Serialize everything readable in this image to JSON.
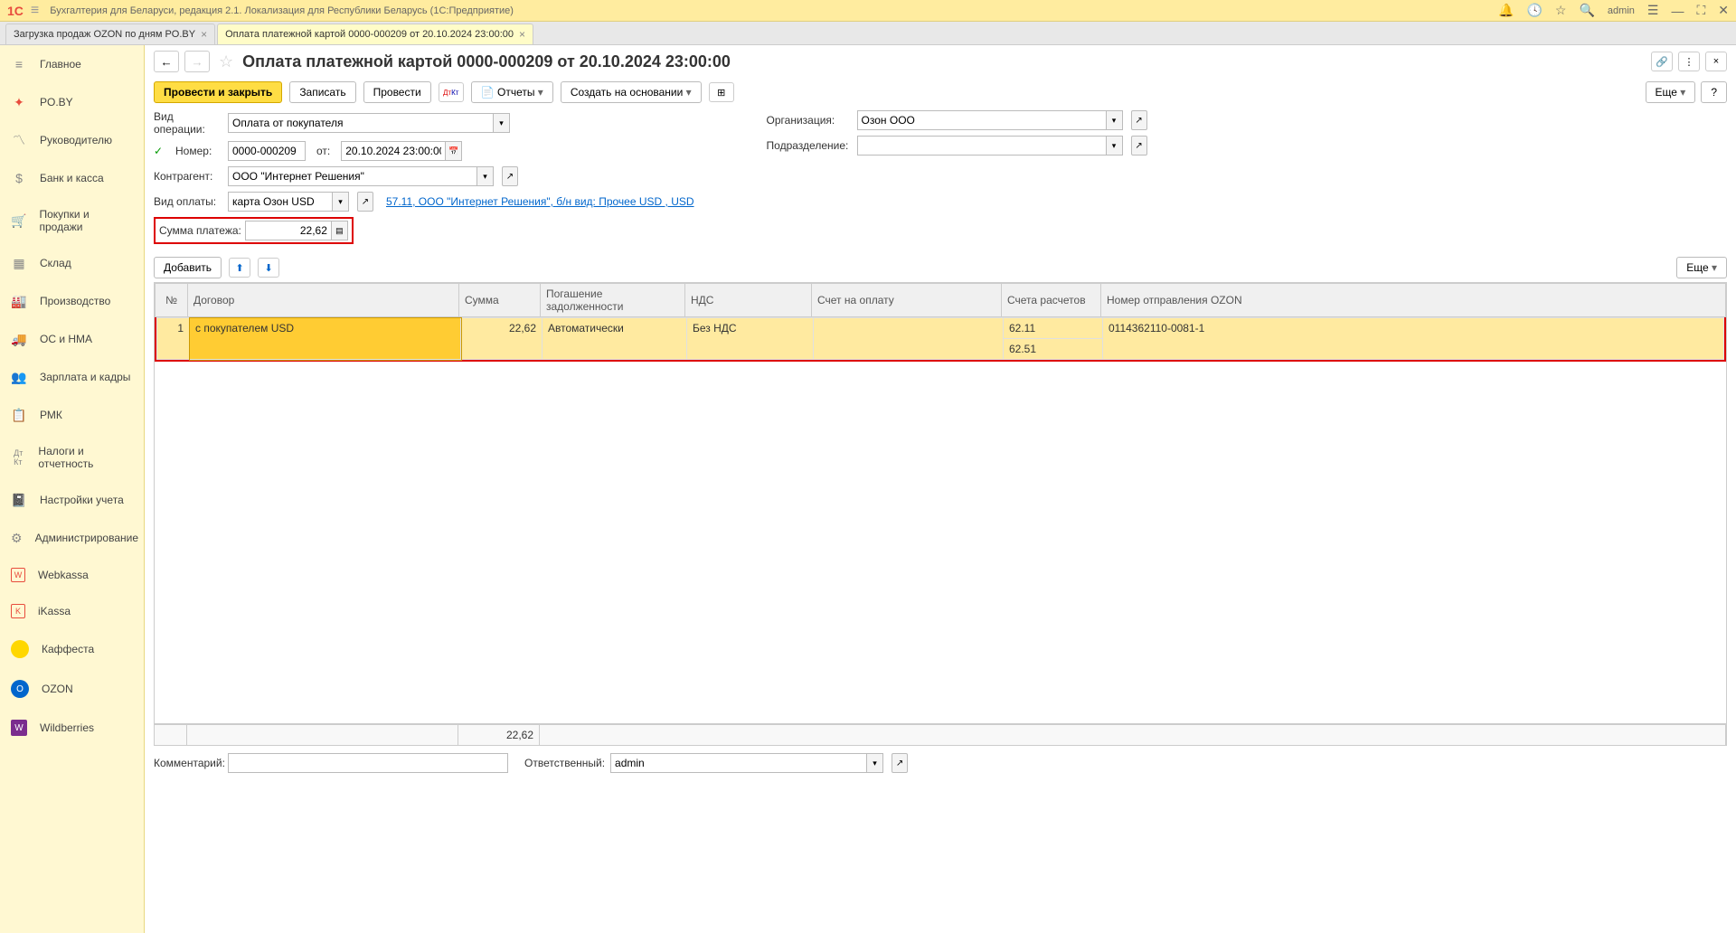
{
  "titlebar": {
    "logo": "1С",
    "title": "Бухгалтерия для Беларуси, редакция 2.1. Локализация для Республики Беларусь   (1С:Предприятие)",
    "user": "admin"
  },
  "tabs": [
    {
      "label": "Загрузка продаж OZON по дням PO.BY",
      "active": false
    },
    {
      "label": "Оплата платежной картой 0000-000209 от 20.10.2024 23:00:00",
      "active": true
    }
  ],
  "nav": [
    {
      "label": "Главное",
      "icon": "≡"
    },
    {
      "label": "PO.BY",
      "icon": "✦"
    },
    {
      "label": "Руководителю",
      "icon": "📈"
    },
    {
      "label": "Банк и касса",
      "icon": "💰"
    },
    {
      "label": "Покупки и продажи",
      "icon": "🛒"
    },
    {
      "label": "Склад",
      "icon": "▦"
    },
    {
      "label": "Производство",
      "icon": "⚙"
    },
    {
      "label": "ОС и НМА",
      "icon": "🚚"
    },
    {
      "label": "Зарплата и кадры",
      "icon": "👥"
    },
    {
      "label": "РМК",
      "icon": "📋"
    },
    {
      "label": "Налоги и отчетность",
      "icon": "Дт"
    },
    {
      "label": "Настройки учета",
      "icon": "📓"
    },
    {
      "label": "Администрирование",
      "icon": "⚙"
    },
    {
      "label": "Webkassa",
      "icon": "W"
    },
    {
      "label": "iKassa",
      "icon": "[K]"
    },
    {
      "label": "Каффеста",
      "icon": ""
    },
    {
      "label": "OZON",
      "icon": "O"
    },
    {
      "label": "Wildberries",
      "icon": "W"
    }
  ],
  "doc": {
    "title": "Оплата платежной картой 0000-000209 от 20.10.2024 23:00:00"
  },
  "toolbar": {
    "post_close": "Провести и закрыть",
    "record": "Записать",
    "post": "Провести",
    "reports": "Отчеты",
    "create_based": "Создать на основании",
    "more": "Еще",
    "help": "?"
  },
  "form": {
    "op_type_label": "Вид операции:",
    "op_type": "Оплата от покупателя",
    "number_label": "Номер:",
    "number": "0000-000209",
    "from_label": "от:",
    "date": "20.10.2024 23:00:00",
    "org_label": "Организация:",
    "org": "Озон ООО",
    "dept_label": "Подразделение:",
    "dept": "",
    "counterparty_label": "Контрагент:",
    "counterparty": "ООО \"Интернет Решения\"",
    "pay_type_label": "Вид оплаты:",
    "pay_type": "карта Озон USD",
    "pay_link": "57.11, ООО \"Интернет Решения\", б/н вид: Прочее USD , USD",
    "sum_label": "Сумма платежа:",
    "sum": "22,62"
  },
  "table_toolbar": {
    "add": "Добавить",
    "more": "Еще"
  },
  "table": {
    "headers": [
      "№",
      "Договор",
      "Сумма",
      "Погашение задолженности",
      "НДС",
      "Счет на оплату",
      "Счета расчетов",
      "Номер отправления OZON"
    ],
    "rows": [
      {
        "n": "1",
        "contract": "с покупателем USD",
        "sum": "22,62",
        "repay": "Автоматически",
        "vat": "Без НДС",
        "invoice": "",
        "acc1": "62.11",
        "acc2": "62.51",
        "ozon": "0114362110-0081-1"
      }
    ],
    "footer_sum": "22,62"
  },
  "bottom": {
    "comment_label": "Комментарий:",
    "comment": "",
    "responsible_label": "Ответственный:",
    "responsible": "admin"
  }
}
